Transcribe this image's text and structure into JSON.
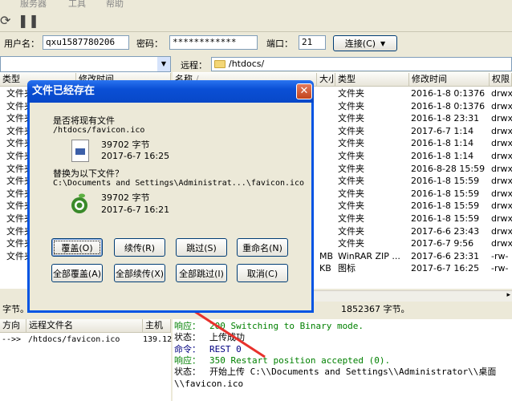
{
  "menu": [
    "服务器",
    "工具",
    "帮助"
  ],
  "connection": {
    "user_label": "用户名：",
    "user_value": "qxu1587780206",
    "password_label": "密码：",
    "password_value": "************",
    "port_label": "端口：",
    "port_value": "21",
    "connect_label": "连接(C)"
  },
  "local": {
    "headers": [
      "类型",
      "修改时间"
    ],
    "rows": [
      "文件夹",
      "文件夹",
      "文件夹",
      "文件夹",
      "文件夹",
      "文件夹",
      "文件夹",
      "文件夹",
      "文件夹",
      "文件夹",
      "文件夹",
      "文件夹",
      "文件夹",
      "文件夹"
    ],
    "status": "字节。"
  },
  "remote": {
    "path_label": "远程：",
    "path_value": "/htdocs/",
    "headers": [
      "名称",
      "大小",
      "类型",
      "修改时间",
      "权限"
    ],
    "rows": [
      {
        "size": "",
        "type": "文件夹",
        "date": "2016-1-8 0:1376",
        "perm": "drwx"
      },
      {
        "size": "",
        "type": "文件夹",
        "date": "2016-1-8 0:1376",
        "perm": "drwx"
      },
      {
        "size": "",
        "type": "文件夹",
        "date": "2016-1-8 23:31",
        "perm": "drwx"
      },
      {
        "size": "",
        "type": "文件夹",
        "date": "2017-6-7 1:14",
        "perm": "drwx"
      },
      {
        "size": "",
        "type": "文件夹",
        "date": "2016-1-8 1:14",
        "perm": "drwx"
      },
      {
        "size": "",
        "type": "文件夹",
        "date": "2016-1-8 1:14",
        "perm": "drwx"
      },
      {
        "size": "",
        "type": "文件夹",
        "date": "2016-8-28 15:59",
        "perm": "drwx"
      },
      {
        "size": "",
        "type": "文件夹",
        "date": "2016-1-8 15:59",
        "perm": "drwx"
      },
      {
        "size": "",
        "type": "文件夹",
        "date": "2016-1-8 15:59",
        "perm": "drwx"
      },
      {
        "size": "",
        "type": "文件夹",
        "date": "2016-1-8 15:59",
        "perm": "drwx"
      },
      {
        "size": "",
        "type": "文件夹",
        "date": "2016-1-8 15:59",
        "perm": "drwx"
      },
      {
        "size": "",
        "type": "文件夹",
        "date": "2017-6-6 23:43",
        "perm": "drwx"
      },
      {
        "size": "",
        "type": "文件夹",
        "date": "2017-6-7 9:56",
        "perm": "drwx"
      },
      {
        "size": "MB",
        "type": "WinRAR ZIP ...",
        "date": "2017-6-6 23:31",
        "perm": "-rw-"
      },
      {
        "size": "KB",
        "type": "图标",
        "date": "2017-6-7 16:25",
        "perm": "-rw-"
      }
    ],
    "status": "1852367 字节。"
  },
  "queue": {
    "headers": [
      "方向",
      "远程文件名",
      "主机"
    ],
    "row": {
      "dir": "-->>",
      "file": "/htdocs/favicon.ico",
      "host": "139.12"
    }
  },
  "log": [
    {
      "tag": "响应：",
      "text": "200 Switching to Binary mode."
    },
    {
      "tag": "状态：",
      "text": "上传成功"
    },
    {
      "tag": "命令：",
      "text": "REST 0"
    },
    {
      "tag": "响应：",
      "text": "350 Restart position accepted (0)."
    },
    {
      "tag": "状态：",
      "text": "开始上传 C:\\\\Documents and Settings\\\\Administrator\\\\桌面"
    },
    {
      "tag": "",
      "text": "\\\\favicon.ico"
    }
  ],
  "dialog": {
    "title": "文件已经存在",
    "existing_label": "是否将现有文件",
    "existing_path": "/htdocs/favicon.ico",
    "existing_size": "39702 字节",
    "existing_date": "2017-6-7 16:25",
    "replace_label": "替换为以下文件？",
    "new_path": "C:\\Documents and Settings\\Administrat...\\favicon.ico",
    "new_size": "39702 字节",
    "new_date": "2017-6-7 16:21",
    "buttons": {
      "overwrite": "覆盖(O)",
      "resume": "续传(R)",
      "skip": "跳过(S)",
      "rename": "重命名(N)",
      "overwrite_all": "全部覆盖(A)",
      "resume_all": "全部续传(X)",
      "skip_all": "全部跳过(I)",
      "cancel": "取消(C)"
    }
  },
  "colors": {
    "titlebar": "#0a4fd5",
    "window_bg": "#ece9d8",
    "arrow": "#e8312c"
  }
}
